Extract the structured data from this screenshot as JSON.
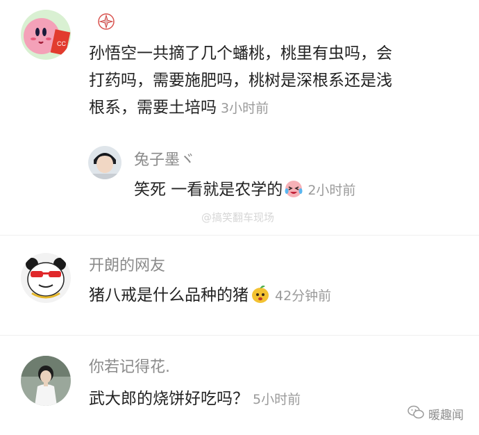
{
  "comments": [
    {
      "avatar_icon": "kirby-avatar",
      "badge_icon": "seal-badge-icon",
      "text_lines": [
        "孙悟空一共摘了几个蟠桃，桃里有虫吗，会",
        "打药吗，需要施肥吗，桃树是深根系还是浅",
        "根系，需要土培吗"
      ],
      "time": "3小时前",
      "reply": {
        "avatar_icon": "boy-photo-avatar",
        "name": "兔子墨ヾ",
        "text": "笑死 一看就是农学的",
        "emoji": "laughing-tears-emoji",
        "time": "2小时前"
      }
    },
    {
      "avatar_icon": "panda-sunglasses-avatar",
      "name": "开朗的网友",
      "text": "猪八戒是什么品种的猪",
      "emoji": "orange-face-emoji",
      "time": "42分钟前"
    },
    {
      "avatar_icon": "person-photo-avatar",
      "name": "你若记得花.",
      "text": "武大郎的烧饼好吃吗？",
      "time": "5小时前"
    }
  ],
  "watermark": "@搞笑翻车现场",
  "watermark_bottom": "暖趣闻",
  "colors": {
    "text": "#222222",
    "meta": "#9a9a9a"
  }
}
